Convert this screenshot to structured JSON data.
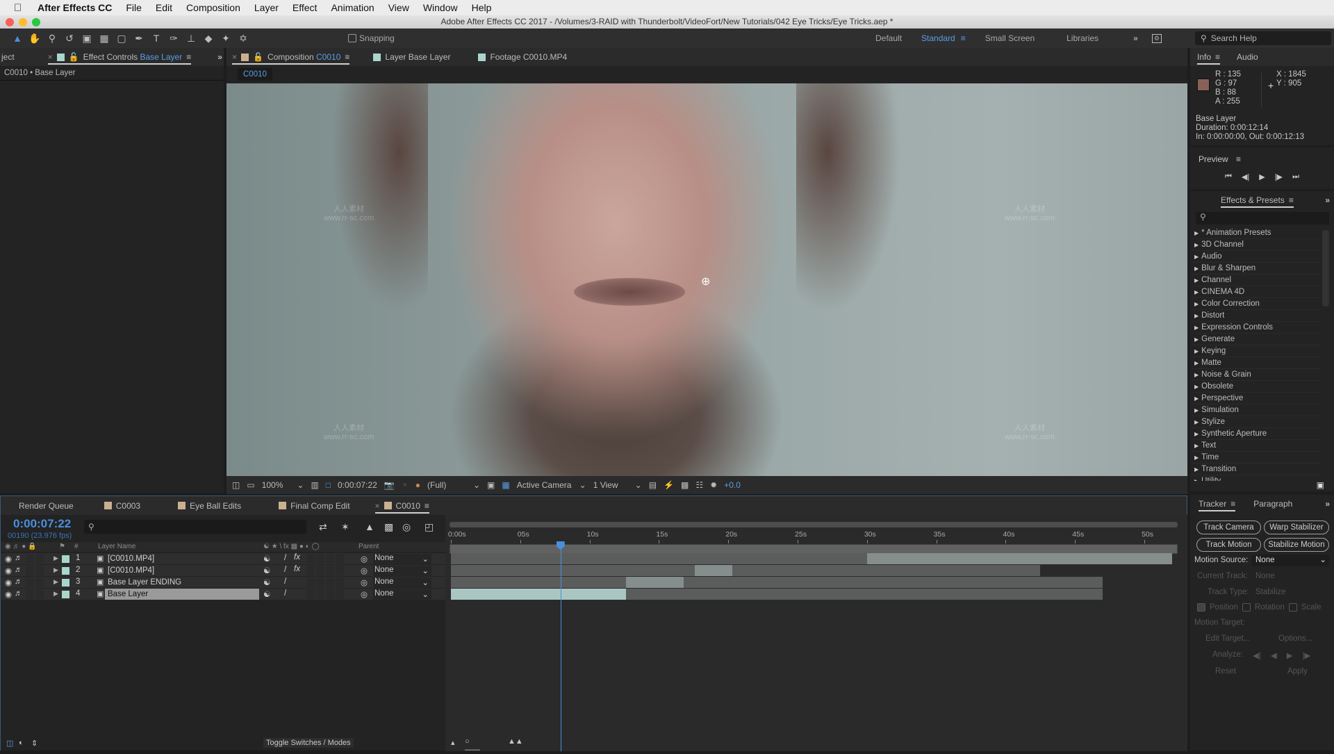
{
  "menubar": {
    "app_name": "After Effects CC",
    "items": [
      "File",
      "Edit",
      "Composition",
      "Layer",
      "Effect",
      "Animation",
      "View",
      "Window",
      "Help"
    ]
  },
  "window_title": "Adobe After Effects CC 2017 - /Volumes/3-RAID with Thunderbolt/VideoFort/New Tutorials/042 Eye Tricks/Eye Tricks.aep *",
  "toolbar": {
    "snapping_label": "Snapping",
    "workspaces": [
      "Default",
      "Standard",
      "Small Screen",
      "Libraries"
    ],
    "active_workspace": "Standard",
    "search_placeholder": "Search Help"
  },
  "left_panel": {
    "tabs": [
      {
        "label": "ject"
      },
      {
        "label": "Effect Controls",
        "highlight": "Base Layer"
      }
    ],
    "breadcrumb": "C0010 • Base Layer"
  },
  "comp_panel": {
    "tabs": [
      {
        "label": "Composition",
        "highlight": "C0010",
        "active": true
      },
      {
        "label": "Layer Base Layer"
      },
      {
        "label": "Footage C0010.MP4"
      }
    ],
    "comp_subtab": "C0010",
    "viewer_toolbar": {
      "zoom": "100%",
      "timecode": "0:00:07:22",
      "resolution": "(Full)",
      "camera": "Active Camera",
      "views": "1 View",
      "exposure": "+0.0"
    }
  },
  "info_panel": {
    "tabs": [
      "Info",
      "Audio"
    ],
    "color_swatch": "#876158",
    "r": "R : 135",
    "g": "G : 97",
    "b": "B : 88",
    "a": "A : 255",
    "x": "X : 1845",
    "y": "Y : 905",
    "layer_name": "Base Layer",
    "duration": "Duration: 0:00:12:14",
    "in_out": "In: 0:00:00:00, Out: 0:00:12:13"
  },
  "preview_panel": {
    "title": "Preview"
  },
  "effects_panel": {
    "title": "Effects & Presets",
    "items": [
      "* Animation Presets",
      "3D Channel",
      "Audio",
      "Blur & Sharpen",
      "Channel",
      "CINEMA 4D",
      "Color Correction",
      "Distort",
      "Expression Controls",
      "Generate",
      "Keying",
      "Matte",
      "Noise & Grain",
      "Obsolete",
      "Perspective",
      "Simulation",
      "Stylize",
      "Synthetic Aperture",
      "Text",
      "Time",
      "Transition",
      "Utility"
    ]
  },
  "tracker_panel": {
    "tabs": [
      "Tracker",
      "Paragraph"
    ],
    "buttons": [
      "Track Camera",
      "Warp Stabilizer",
      "Track Motion",
      "Stabilize Motion"
    ],
    "motion_source_label": "Motion Source:",
    "motion_source_value": "None",
    "current_track_label": "Current Track:",
    "current_track_value": "None",
    "track_type_label": "Track Type:",
    "track_type_value": "Stabilize",
    "checks": [
      {
        "label": "Position",
        "checked": true
      },
      {
        "label": "Rotation",
        "checked": false
      },
      {
        "label": "Scale",
        "checked": false
      }
    ],
    "motion_target_label": "Motion Target:",
    "edit_target": "Edit Target...",
    "options": "Options...",
    "analyze_label": "Analyze:",
    "reset": "Reset",
    "apply": "Apply"
  },
  "timeline": {
    "tabs": [
      "Render Queue",
      "C0003",
      "Eye Ball Edits",
      "Final Comp Edit",
      "C0010"
    ],
    "active_tab": "C0010",
    "timecode": "0:00:07:22",
    "frame_info": "00190 (23.976 fps)",
    "columns": {
      "num": "#",
      "layer_name": "Layer Name",
      "parent": "Parent"
    },
    "layers": [
      {
        "num": "1",
        "name": "[C0010.MP4]",
        "fx": true,
        "parent": "None",
        "bar_start": 0,
        "bar_end": 52,
        "highlight_start": 30,
        "highlight_end": 52
      },
      {
        "num": "2",
        "name": "[C0010.MP4]",
        "fx": true,
        "parent": "None",
        "bar_start": 0,
        "bar_end": 42.5,
        "highlight_start": 17.6,
        "highlight_end": 20.3
      },
      {
        "num": "3",
        "name": "Base Layer  ENDING",
        "fx": false,
        "parent": "None",
        "bar_start": 0,
        "bar_end": 47,
        "highlight_start": 12.6,
        "highlight_end": 16.8
      },
      {
        "num": "4",
        "name": "Base Layer",
        "fx": false,
        "parent": "None",
        "selected": true,
        "bar_start": 0,
        "bar_end": 47,
        "highlight_start": 0,
        "highlight_end": 12.6
      }
    ],
    "ruler_ticks": [
      "0:00s",
      "05s",
      "10s",
      "15s",
      "20s",
      "25s",
      "30s",
      "35s",
      "40s",
      "45s",
      "50s"
    ],
    "cti_seconds": 7.9,
    "toggle_label": "Toggle Switches / Modes"
  },
  "watermark": {
    "text_cn": "人人素材",
    "url": "www.rr-sc.com"
  }
}
